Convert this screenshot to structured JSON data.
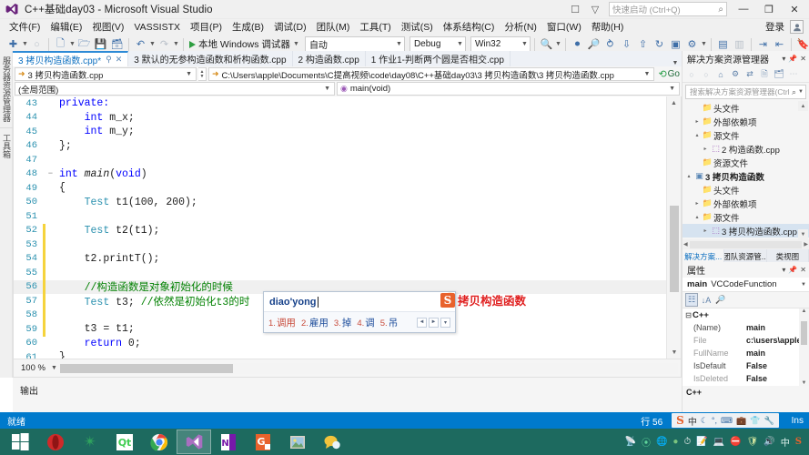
{
  "window": {
    "title": "C++基础day03 - Microsoft Visual Studio",
    "logo_icon": "visual-studio-icon",
    "feedback_icon": "feedback-icon",
    "filter_icon": "filter-icon",
    "quick_launch_placeholder": "快速启动 (Ctrl+Q)",
    "search_icon": "search-icon",
    "minimize": "—",
    "restore": "❐",
    "close": "✕"
  },
  "menubar": {
    "items": [
      {
        "label": "文件(F)"
      },
      {
        "label": "编辑(E)"
      },
      {
        "label": "视图(V)"
      },
      {
        "label": "VASSISTX"
      },
      {
        "label": "项目(P)"
      },
      {
        "label": "生成(B)"
      },
      {
        "label": "调试(D)"
      },
      {
        "label": "团队(M)"
      },
      {
        "label": "工具(T)"
      },
      {
        "label": "测试(S)"
      },
      {
        "label": "体系结构(C)"
      },
      {
        "label": "分析(N)"
      },
      {
        "label": "窗口(W)"
      },
      {
        "label": "帮助(H)"
      }
    ],
    "signin": "登录",
    "account_icon": "account-icon"
  },
  "toolbar": {
    "new_project_icon": "new-project-icon",
    "open_icon": "open-file-icon",
    "save_icon": "save-icon",
    "save_all_icon": "save-all-icon",
    "undo_icon": "undo-icon",
    "redo_icon": "redo-icon",
    "run_label": "本地 Windows 调试器",
    "run_icon": "play-icon",
    "config_value": "自动",
    "solution_config": "Debug",
    "platform": "Win32",
    "extra_icons": [
      "find-in-files-icon",
      "step-over-icon",
      "breakpoint-icon",
      "watch-icon",
      "step-into-icon",
      "step-out-icon",
      "restart-icon",
      "stop-icon",
      "toggle-bookmark-icon",
      "comment-icon",
      "uncomment-icon",
      "indent-icon",
      "outdent-icon",
      "bookmark-icon"
    ]
  },
  "vertical_tabs": [
    {
      "label": "服务器资源管理器"
    },
    {
      "label": "工具箱"
    }
  ],
  "document_tabs": [
    {
      "label": "3 拷贝构造函数.cpp*",
      "active": true,
      "pin": "⚲",
      "close": "✕"
    },
    {
      "label": "3 默认的无参构造函数和析构函数.cpp",
      "active": false
    },
    {
      "label": "2 构造函数.cpp",
      "active": false
    },
    {
      "label": "1 作业1-判断两个圆是否相交.cpp",
      "active": false
    }
  ],
  "navbar": {
    "file_selector": "3 拷贝构造函数.cpp",
    "path": "C:\\Users\\apple\\Documents\\C提高视频\\code\\day08\\C++基础day03\\3 拷贝构造函数\\3 拷贝构造函数.cpp",
    "go_label": "Go",
    "scope": "(全局范围)",
    "member": "main(void)"
  },
  "editor": {
    "zoom": "100 %",
    "lines": [
      {
        "n": "43",
        "changed": false,
        "fold": "",
        "indent": 0,
        "tokens": [
          {
            "t": "private:",
            "c": "kw"
          }
        ]
      },
      {
        "n": "44",
        "changed": false,
        "fold": "",
        "indent": 1,
        "tokens": [
          {
            "t": "int ",
            "c": "kw"
          },
          {
            "t": "m_x;",
            "c": "pl"
          }
        ]
      },
      {
        "n": "45",
        "changed": false,
        "fold": "",
        "indent": 1,
        "tokens": [
          {
            "t": "int ",
            "c": "kw"
          },
          {
            "t": "m_y;",
            "c": "pl"
          }
        ]
      },
      {
        "n": "46",
        "changed": false,
        "fold": "",
        "indent": 0,
        "tokens": [
          {
            "t": "};",
            "c": "pl"
          }
        ]
      },
      {
        "n": "47",
        "changed": false,
        "fold": "",
        "indent": 0,
        "tokens": []
      },
      {
        "n": "48",
        "changed": false,
        "fold": "−",
        "indent": 0,
        "tokens": [
          {
            "t": "int ",
            "c": "kw"
          },
          {
            "t": "main",
            "c": "fn"
          },
          {
            "t": "(",
            "c": "pl"
          },
          {
            "t": "void",
            "c": "kw"
          },
          {
            "t": ")",
            "c": "pl"
          }
        ]
      },
      {
        "n": "49",
        "changed": false,
        "fold": "",
        "indent": 0,
        "tokens": [
          {
            "t": "{",
            "c": "pl"
          }
        ]
      },
      {
        "n": "50",
        "changed": false,
        "fold": "",
        "indent": 1,
        "tokens": [
          {
            "t": "Test",
            "c": "ty"
          },
          {
            "t": " t1(100, 200);",
            "c": "pl"
          }
        ]
      },
      {
        "n": "51",
        "changed": false,
        "fold": "",
        "indent": 0,
        "tokens": []
      },
      {
        "n": "52",
        "changed": true,
        "fold": "",
        "indent": 1,
        "tokens": [
          {
            "t": "Test",
            "c": "ty"
          },
          {
            "t": " t2(t1);",
            "c": "pl"
          }
        ]
      },
      {
        "n": "53",
        "changed": true,
        "fold": "",
        "indent": 0,
        "tokens": []
      },
      {
        "n": "54",
        "changed": true,
        "fold": "",
        "indent": 1,
        "tokens": [
          {
            "t": "t2.printT();",
            "c": "pl"
          }
        ]
      },
      {
        "n": "55",
        "changed": true,
        "fold": "",
        "indent": 0,
        "tokens": []
      },
      {
        "n": "56",
        "changed": true,
        "fold": "",
        "indent": 1,
        "highlight": true,
        "tokens": [
          {
            "t": "//构造函数是对象初始化的时候",
            "c": "cm"
          }
        ]
      },
      {
        "n": "57",
        "changed": true,
        "fold": "",
        "indent": 1,
        "tokens": [
          {
            "t": "Test",
            "c": "ty"
          },
          {
            "t": " t3; ",
            "c": "pl"
          },
          {
            "t": "//依然是初始化t3的时",
            "c": "cm"
          }
        ]
      },
      {
        "n": "58",
        "changed": true,
        "fold": "",
        "indent": 0,
        "tokens": []
      },
      {
        "n": "59",
        "changed": true,
        "fold": "",
        "indent": 1,
        "tokens": [
          {
            "t": "t3 = t1;",
            "c": "pl"
          }
        ]
      },
      {
        "n": "60",
        "changed": false,
        "fold": "",
        "indent": 1,
        "tokens": [
          {
            "t": "return ",
            "c": "kw"
          },
          {
            "t": "0;",
            "c": "pl"
          }
        ]
      },
      {
        "n": "61",
        "changed": false,
        "fold": "",
        "indent": 0,
        "tokens": [
          {
            "t": "}",
            "c": "pl"
          }
        ]
      }
    ]
  },
  "ime": {
    "composition": "diao'yong",
    "candidates": [
      {
        "index": "1.",
        "word": "调用"
      },
      {
        "index": "2.",
        "word": "雇用"
      },
      {
        "index": "3.",
        "word": "掉"
      },
      {
        "index": "4.",
        "word": "调"
      },
      {
        "index": "5.",
        "word": "吊"
      }
    ],
    "prev_icon": "◄",
    "next_icon": "►",
    "more_icon": "▾",
    "logo": "S"
  },
  "annotation": {
    "logo": "S",
    "text": "拷贝构造函数"
  },
  "solution_explorer": {
    "title": "解决方案资源管理器",
    "header_icons": [
      "overflow-icon",
      "dropdown-icon",
      "pin-icon",
      "close-icon"
    ],
    "toolbar_icons": [
      "back-icon",
      "forward-icon",
      "home-icon",
      "properties-icon",
      "refresh-icon",
      "show-all-files-icon",
      "collapse-all-icon",
      "overflow-icon"
    ],
    "search_placeholder": "搜索解决方案资源管理器(Ctrl+",
    "tree": [
      {
        "label": "头文件",
        "icon": "folder-icon",
        "depth": 2,
        "twisty": "",
        "bold": false
      },
      {
        "label": "外部依赖项",
        "icon": "folder-icon",
        "depth": 2,
        "twisty": "▸",
        "bold": false
      },
      {
        "label": "源文件",
        "icon": "folder-icon",
        "depth": 2,
        "twisty": "▴",
        "bold": false
      },
      {
        "label": "2 构造函数.cpp",
        "icon": "cpp-file-icon",
        "depth": 3,
        "twisty": "▸",
        "bold": false
      },
      {
        "label": "资源文件",
        "icon": "folder-icon",
        "depth": 2,
        "twisty": "",
        "bold": false
      },
      {
        "label": "3 拷贝构造函数",
        "icon": "project-icon",
        "depth": 1,
        "twisty": "▴",
        "bold": true
      },
      {
        "label": "头文件",
        "icon": "folder-icon",
        "depth": 2,
        "twisty": "",
        "bold": false
      },
      {
        "label": "外部依赖项",
        "icon": "folder-icon",
        "depth": 2,
        "twisty": "▸",
        "bold": false
      },
      {
        "label": "源文件",
        "icon": "folder-icon",
        "depth": 2,
        "twisty": "▴",
        "bold": false
      },
      {
        "label": "3 拷贝构造函数.cpp",
        "icon": "cpp-file-icon",
        "depth": 3,
        "twisty": "▸",
        "bold": false,
        "selected": true
      },
      {
        "label": "资源文件",
        "icon": "folder-icon",
        "depth": 2,
        "twisty": "",
        "bold": false
      }
    ],
    "tabs": [
      {
        "label": "解决方案...",
        "active": true
      },
      {
        "label": "团队资源管...",
        "active": false
      },
      {
        "label": "类视图",
        "active": false
      }
    ]
  },
  "properties": {
    "title": "属性",
    "header_icons": [
      "dropdown-icon",
      "pin-icon",
      "close-icon"
    ],
    "object_name": "main",
    "object_type": "VCCodeFunction",
    "toolbar_icons": [
      "categorized-icon",
      "alphabetical-icon",
      "property-pages-icon"
    ],
    "group": "C++",
    "rows": [
      {
        "key": "(Name)",
        "value": "main",
        "dim": false
      },
      {
        "key": "File",
        "value": "c:\\users\\apple",
        "dim": true
      },
      {
        "key": "FullName",
        "value": "main",
        "dim": true
      },
      {
        "key": "IsDefault",
        "value": "False",
        "dim": false
      },
      {
        "key": "IsDeleted",
        "value": "False",
        "dim": true
      }
    ],
    "footer": "C++"
  },
  "output": {
    "title": "输出"
  },
  "statusbar": {
    "ready": "就绪",
    "line": "行 56",
    "ins": "Ins",
    "ime": {
      "logo": "S",
      "mode": "中",
      "icons": [
        "moon-icon",
        "punctuation-icon",
        "keyboard-icon",
        "toolbox-icon",
        "skin-icon",
        "settings-icon"
      ]
    }
  },
  "taskbar": {
    "start_icon": "windows-start-icon",
    "items": [
      {
        "name": "opera-icon",
        "glyph": "",
        "color": "#cf2a2a"
      },
      {
        "name": "greenshot-icon",
        "glyph": "✳",
        "color": "#2e7d4f"
      },
      {
        "name": "qt-creator-icon",
        "glyph": "Qt",
        "color": "#41cd52"
      },
      {
        "name": "chrome-icon",
        "glyph": "",
        "color": "#4285f4"
      },
      {
        "name": "visual-studio-icon",
        "glyph": "",
        "color": "#68217a",
        "active": true
      },
      {
        "name": "onenote-icon",
        "glyph": "N",
        "color": "#7719aa"
      },
      {
        "name": "pdf-reader-icon",
        "glyph": "G",
        "color": "#e8622c"
      },
      {
        "name": "photo-viewer-icon",
        "glyph": "",
        "color": "#e3a83a"
      },
      {
        "name": "messenger-icon",
        "glyph": "",
        "color": "#f2c33c"
      }
    ],
    "tray": {
      "mode": "中",
      "sogou": "S",
      "icons": [
        "network-icon",
        "sync-icon",
        "shield-icon",
        "update-icon",
        "clock-icon",
        "app-icon",
        "monitor-icon",
        "block-icon",
        "security-icon",
        "volume-icon"
      ]
    }
  }
}
